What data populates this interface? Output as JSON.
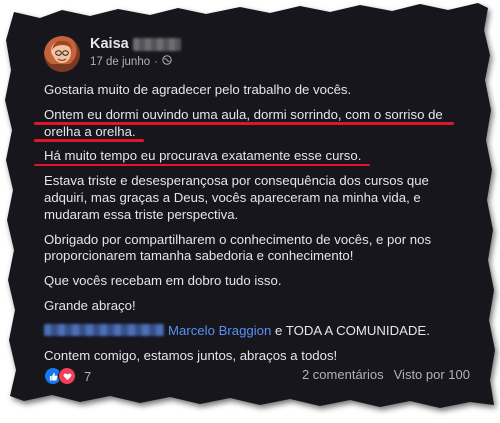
{
  "post": {
    "author_name": "Kaisa",
    "date": "17 de junho",
    "date_separator": "·",
    "paragraphs": {
      "p1": "Gostaria muito de agradecer pelo trabalho de vocês.",
      "p2": "Ontem eu dormi ouvindo uma aula, dormi sorrindo, com o sorriso de orelha a orelha.",
      "p3": "Há muito tempo eu procurava exatamente esse curso.",
      "p4": "Estava triste e desesperançosa por consequência dos cursos que adquiri, mas graças a Deus, vocês apareceram na minha vida, e mudaram essa triste perspectiva.",
      "p5": "Obrigado por compartilharem o conhecimento de vocês, e por nos proporcionarem tamanha sabedoria e conhecimento!",
      "p6": "Que vocês recebam em dobro tudo isso.",
      "p7": "Grande abraço!",
      "p8_mention": "Marcelo Braggion",
      "p8_rest": " e TODA A COMUNIDADE.",
      "p9": "Contem comigo, estamos juntos, abraços a todos!"
    },
    "reactions_count": "7",
    "comments": "2 comentários",
    "views": "Visto por 100",
    "highlight_color": "#e0152b",
    "mention_color": "#5b8ff5"
  }
}
